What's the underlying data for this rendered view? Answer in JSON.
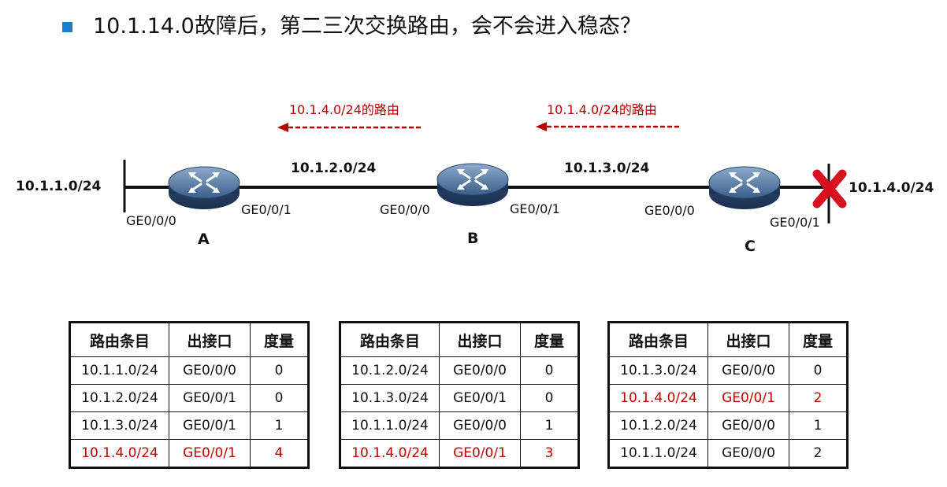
{
  "title": "10.1.14.0故障后，第二三次交换路由，会不会进入稳态？",
  "route_notes": [
    "10.1.4.0/24的路由",
    "10.1.4.0/24的路由"
  ],
  "networks": {
    "left": "10.1.1.0/24",
    "ab": "10.1.2.0/24",
    "bc": "10.1.3.0/24",
    "right": "10.1.4.0/24"
  },
  "routers": [
    {
      "name": "A",
      "port_left": "GE0/0/0",
      "port_right": "GE0/0/1"
    },
    {
      "name": "B",
      "port_left": "GE0/0/0",
      "port_right": "GE0/0/1"
    },
    {
      "name": "C",
      "port_left": "GE0/0/0",
      "port_right": "GE0/0/1"
    }
  ],
  "colors": {
    "accent": "#1f7cc6",
    "alert": "#c00000",
    "router": "#3b5f8a"
  },
  "table_headers": [
    "路由条目",
    "出接口",
    "度量"
  ],
  "tables": [
    {
      "router": "A",
      "rows": [
        {
          "dest": "10.1.1.0/24",
          "iface": "GE0/0/0",
          "metric": "0",
          "highlight": false
        },
        {
          "dest": "10.1.2.0/24",
          "iface": "GE0/0/1",
          "metric": "0",
          "highlight": false
        },
        {
          "dest": "10.1.3.0/24",
          "iface": "GE0/0/1",
          "metric": "1",
          "highlight": false
        },
        {
          "dest": "10.1.4.0/24",
          "iface": "GE0/0/1",
          "metric": "4",
          "highlight": true
        }
      ]
    },
    {
      "router": "B",
      "rows": [
        {
          "dest": "10.1.2.0/24",
          "iface": "GE0/0/0",
          "metric": "0",
          "highlight": false
        },
        {
          "dest": "10.1.3.0/24",
          "iface": "GE0/0/1",
          "metric": "0",
          "highlight": false
        },
        {
          "dest": "10.1.1.0/24",
          "iface": "GE0/0/0",
          "metric": "1",
          "highlight": false
        },
        {
          "dest": "10.1.4.0/24",
          "iface": "GE0/0/1",
          "metric": "3",
          "highlight": true
        }
      ]
    },
    {
      "router": "C",
      "rows": [
        {
          "dest": "10.1.3.0/24",
          "iface": "GE0/0/0",
          "metric": "0",
          "highlight": false
        },
        {
          "dest": "10.1.4.0/24",
          "iface": "GE0/0/1",
          "metric": "2",
          "highlight": true
        },
        {
          "dest": "10.1.2.0/24",
          "iface": "GE0/0/0",
          "metric": "1",
          "highlight": false
        },
        {
          "dest": "10.1.1.0/24",
          "iface": "GE0/0/0",
          "metric": "2",
          "highlight": false
        }
      ]
    }
  ]
}
